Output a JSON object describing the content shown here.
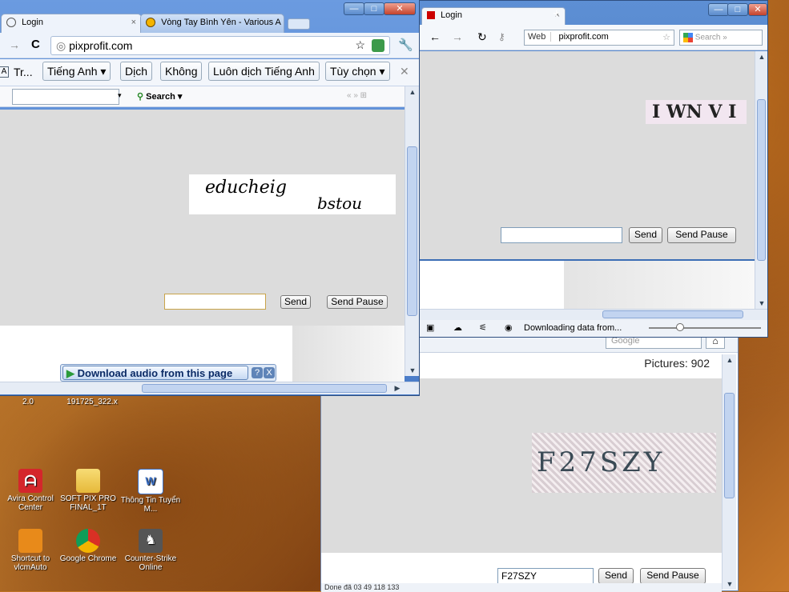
{
  "desktop": {
    "icons": [
      {
        "label": "Avira Control Center",
        "icon": "avira-icon",
        "color": "#d4262b"
      },
      {
        "label": "SOFT PIX PRO FINAL_1T",
        "icon": "folder-icon",
        "color": "#f2c94c"
      },
      {
        "label": "Thông Tin Tuyển M...",
        "icon": "word-doc-icon",
        "color": "#3a6fc4"
      },
      {
        "label": "Shortcut to vlcmAuto",
        "icon": "vlc-icon",
        "color": "#e88a1a"
      },
      {
        "label": "Google Chrome",
        "icon": "chrome-icon",
        "color": "#4a90d9"
      },
      {
        "label": "Counter-Strike Online",
        "icon": "counter-strike-icon",
        "color": "#444444"
      }
    ],
    "partial_labels": [
      "2.0",
      "191725_322.x"
    ]
  },
  "chrome_window": {
    "tabs": [
      {
        "label": "Login",
        "active": true
      },
      {
        "label": "Vòng Tay Bình Yên - Various A",
        "active": false
      }
    ],
    "address": "pixprofit.com",
    "translate_bar": {
      "partial": "Tr...",
      "language": "Tiếng Anh",
      "translate": "Dịch",
      "no": "Không",
      "always": "Luôn dịch Tiếng Anh",
      "options": "Tùy chọn"
    },
    "toolbar": {
      "search_label": "Search"
    },
    "captcha": {
      "text1": "educheig",
      "text2": "bstou"
    },
    "form": {
      "input_value": "",
      "send": "Send",
      "send_pause": "Send Pause"
    },
    "audio_bar": {
      "label": "Download audio from this page",
      "help": "?",
      "close": "X"
    }
  },
  "firefox_window": {
    "tab": "Login",
    "address_badge": "Web",
    "address": "pixprofit.com",
    "search_placeholder": "Search »",
    "captcha": {
      "text": "I WN V I"
    },
    "form": {
      "input_value": "",
      "send": "Send",
      "send_pause": "Send Pause"
    },
    "status": "Downloading data from..."
  },
  "third_window": {
    "pictures_label": "Pictures: 902",
    "search_placeholder": "Google",
    "captcha": {
      "text": "F27SZY"
    },
    "form": {
      "input_value": "F27SZY",
      "send": "Send",
      "send_pause": "Send Pause"
    },
    "status": "Done đã 03 49 118 133"
  }
}
